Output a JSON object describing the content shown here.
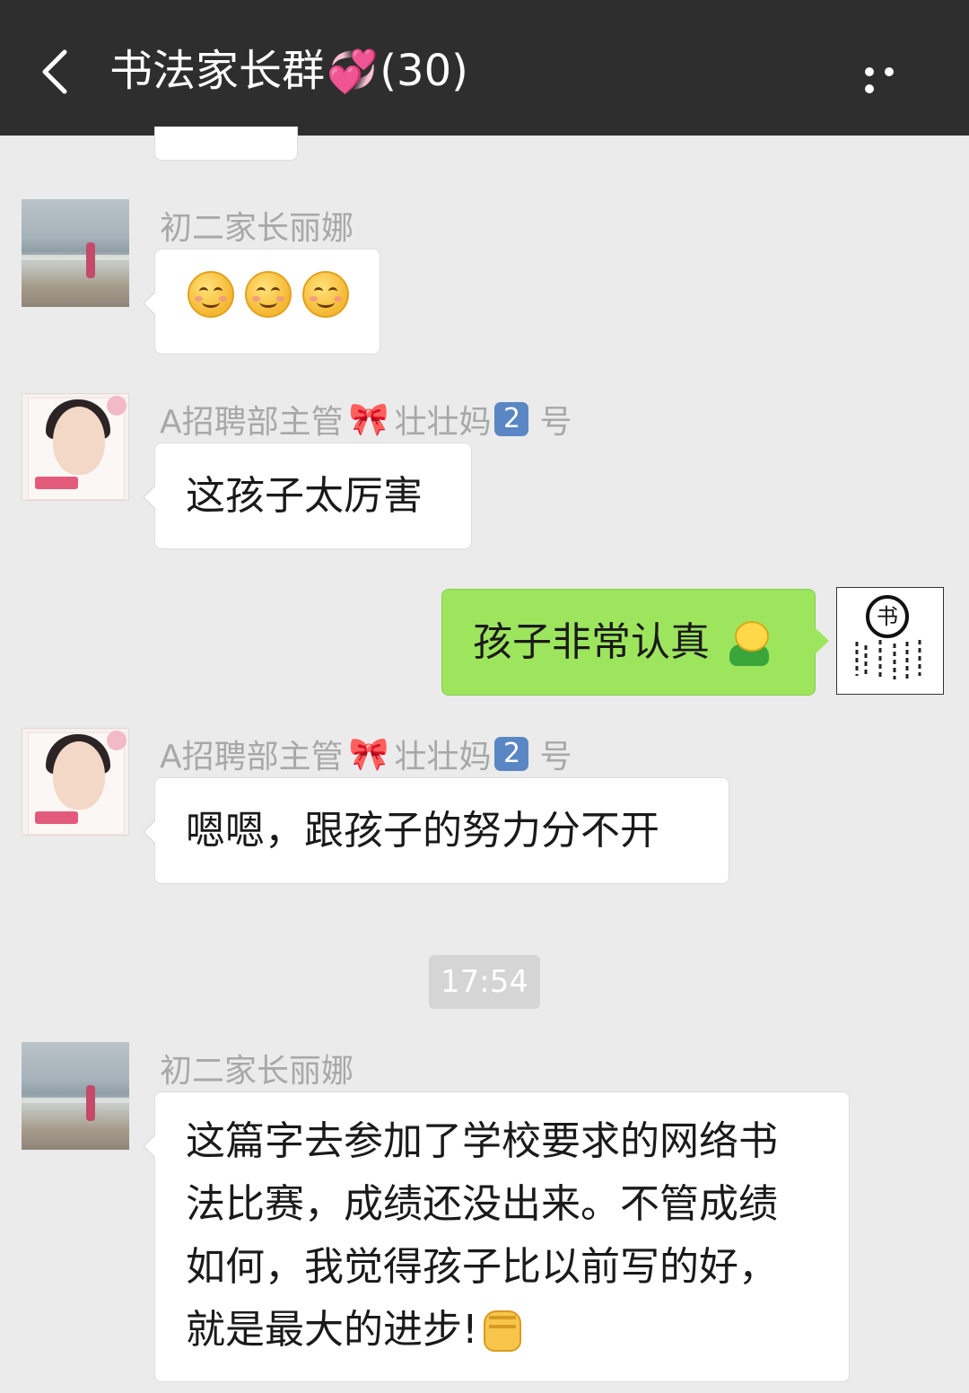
{
  "header": {
    "title": "书法家长群",
    "heart_emoji": "💞",
    "member_count": "(30)",
    "back_icon": "chevron-left-icon",
    "more_icon": "more-dots-icon"
  },
  "messages": [
    {
      "sender": "初二家长丽娜",
      "emoji": [
        "😊",
        "😊",
        "😊"
      ]
    },
    {
      "sender_prefix": "A招聘部主管",
      "sender_bow": "🎀",
      "sender_name": "壮壮妈",
      "sender_badge": "2",
      "sender_suffix": "号",
      "text": "这孩子太厉害"
    },
    {
      "outgoing": true,
      "text": "孩子非常认真"
    },
    {
      "sender_prefix": "A招聘部主管",
      "sender_bow": "🎀",
      "sender_name": "壮壮妈",
      "sender_badge": "2",
      "sender_suffix": "号",
      "text": "嗯嗯，跟孩子的努力分不开"
    },
    {
      "sender": "初二家长丽娜",
      "lines": [
        "这篇字去参加了学校要求的网络书",
        "法比赛，成绩还没出来。不管成绩",
        "如何，我觉得孩子比以前写的好，",
        "就是最大的进步!"
      ]
    }
  ],
  "timestamp": "17:54",
  "colors": {
    "topbar": "#2e2e2e",
    "background": "#ebebeb",
    "outgoing_bubble": "#9ee55e",
    "incoming_bubble": "#ffffff",
    "sender_text": "#a8a8a8"
  }
}
